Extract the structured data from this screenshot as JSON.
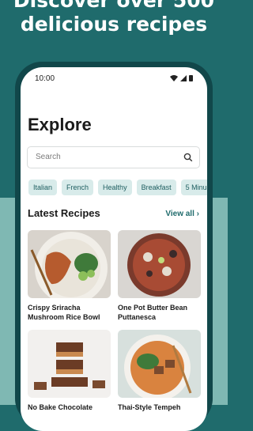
{
  "promo": {
    "headline_line1": "Discover over 500",
    "headline_line2": "delicious recipes"
  },
  "status_bar": {
    "time": "10:00"
  },
  "screen": {
    "title": "Explore",
    "search": {
      "placeholder": "Search"
    },
    "chips": [
      "Italian",
      "French",
      "Healthy",
      "Breakfast",
      "5 Minu"
    ],
    "section": {
      "title": "Latest Recipes",
      "view_all": "View all"
    },
    "recipes": [
      {
        "name": "Crispy Sriracha Mushroom Rice Bowl"
      },
      {
        "name": "One Pot Butter Bean Puttanesca"
      },
      {
        "name": "No Bake Chocolate"
      },
      {
        "name": "Thai-Style Tempeh"
      }
    ]
  },
  "colors": {
    "brand": "#1f6b6c",
    "chip_bg": "#d8ebea",
    "accent_text": "#1f6b6c"
  }
}
